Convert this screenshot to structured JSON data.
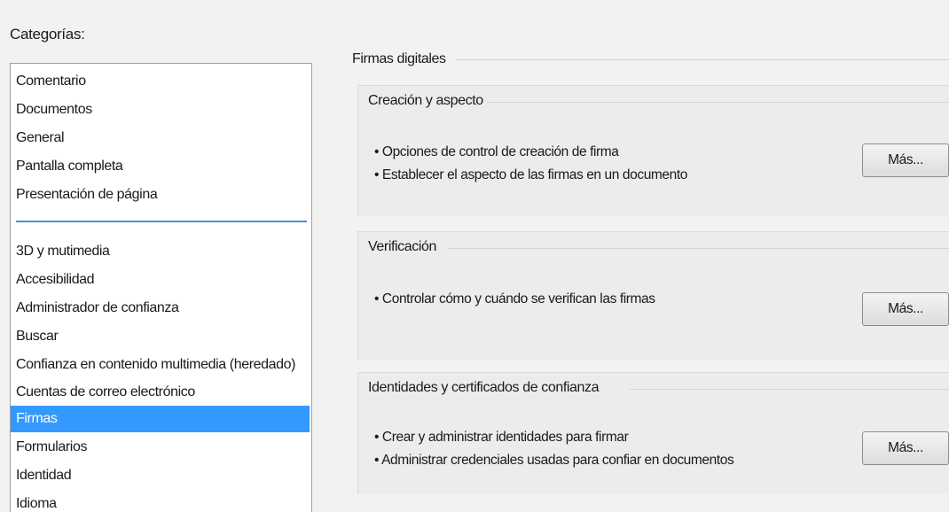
{
  "categories": {
    "label": "Categorías:",
    "items_top": [
      "Comentario",
      "Documentos",
      "General",
      "Pantalla completa",
      "Presentación de página"
    ],
    "items_bottom": [
      "3D y mutimedia",
      "Accesibilidad",
      "Administrador de confianza",
      "Buscar",
      "Confianza en contenido multimedia (heredado)",
      "Cuentas de correo electrónico",
      "Firmas",
      "Formularios",
      "Identidad",
      "Idioma"
    ],
    "selected": "Firmas",
    "selection_color": "#3399ff"
  },
  "main": {
    "section_title": "Firmas digitales",
    "groups": [
      {
        "title": "Creación y aspecto",
        "bullets": [
          "• Opciones de control de creación de firma",
          "• Establecer el aspecto de las firmas en un documento"
        ],
        "button_label": "Más..."
      },
      {
        "title": "Verificación",
        "bullets": [
          "• Controlar cómo y cuándo se verifican las firmas"
        ],
        "button_label": "Más..."
      },
      {
        "title": "Identidades y certificados de confianza",
        "bullets": [
          "• Crear y administrar identidades para firmar",
          "• Administrar credenciales usadas para confiar en documentos"
        ],
        "button_label": "Más..."
      }
    ]
  }
}
